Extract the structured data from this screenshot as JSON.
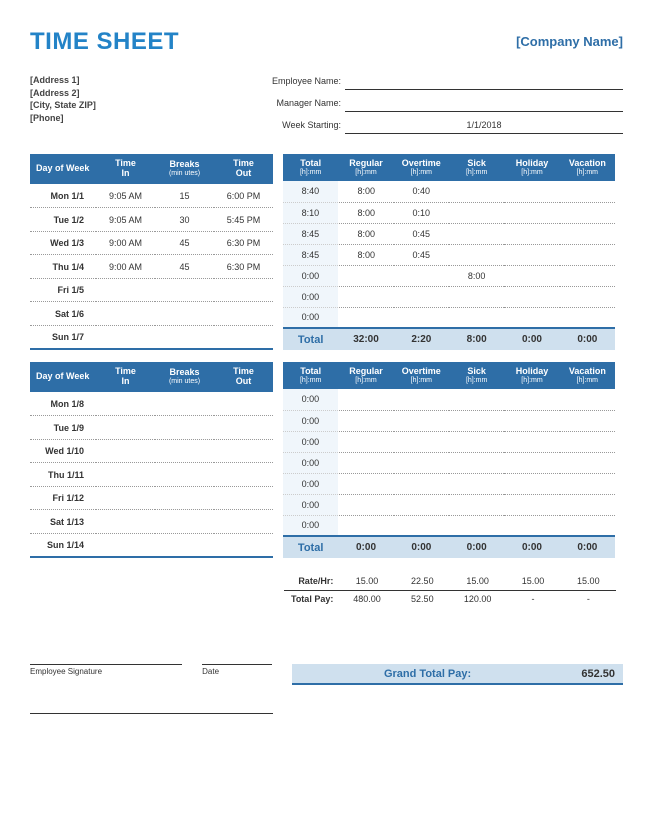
{
  "title": "TIME SHEET",
  "company": "[Company Name]",
  "address": [
    "[Address 1]",
    "[Address 2]",
    "[City, State  ZIP]",
    "[Phone]"
  ],
  "employee": {
    "name_label": "Employee Name:",
    "name_value": "",
    "manager_label": "Manager Name:",
    "manager_value": "",
    "week_label": "Week Starting:",
    "week_value": "1/1/2018"
  },
  "headers_left": [
    "Day of Week",
    "Time\nIn",
    "Breaks",
    "Time\nOut"
  ],
  "headers_left_sub": [
    "",
    "",
    "(min utes)",
    ""
  ],
  "headers_right": [
    "Total",
    "Regular",
    "Overtime",
    "Sick",
    "Holiday",
    "Vacation"
  ],
  "headers_right_sub": "[h]:mm",
  "week1": {
    "rows": [
      {
        "day": "Mon 1/1",
        "in": "9:05 AM",
        "breaks": "15",
        "out": "6:00 PM",
        "total": "8:40",
        "reg": "8:00",
        "ot": "0:40",
        "sick": "",
        "hol": "",
        "vac": ""
      },
      {
        "day": "Tue 1/2",
        "in": "9:05 AM",
        "breaks": "30",
        "out": "5:45 PM",
        "total": "8:10",
        "reg": "8:00",
        "ot": "0:10",
        "sick": "",
        "hol": "",
        "vac": ""
      },
      {
        "day": "Wed 1/3",
        "in": "9:00 AM",
        "breaks": "45",
        "out": "6:30 PM",
        "total": "8:45",
        "reg": "8:00",
        "ot": "0:45",
        "sick": "",
        "hol": "",
        "vac": ""
      },
      {
        "day": "Thu 1/4",
        "in": "9:00 AM",
        "breaks": "45",
        "out": "6:30 PM",
        "total": "8:45",
        "reg": "8:00",
        "ot": "0:45",
        "sick": "",
        "hol": "",
        "vac": ""
      },
      {
        "day": "Fri 1/5",
        "in": "",
        "breaks": "",
        "out": "",
        "total": "0:00",
        "reg": "",
        "ot": "",
        "sick": "8:00",
        "hol": "",
        "vac": ""
      },
      {
        "day": "Sat 1/6",
        "in": "",
        "breaks": "",
        "out": "",
        "total": "0:00",
        "reg": "",
        "ot": "",
        "sick": "",
        "hol": "",
        "vac": ""
      },
      {
        "day": "Sun 1/7",
        "in": "",
        "breaks": "",
        "out": "",
        "total": "0:00",
        "reg": "",
        "ot": "",
        "sick": "",
        "hol": "",
        "vac": ""
      }
    ],
    "total_label": "Total",
    "totals": [
      "32:00",
      "2:20",
      "8:00",
      "0:00",
      "0:00"
    ]
  },
  "week2": {
    "rows": [
      {
        "day": "Mon 1/8",
        "in": "",
        "breaks": "",
        "out": "",
        "total": "0:00",
        "reg": "",
        "ot": "",
        "sick": "",
        "hol": "",
        "vac": ""
      },
      {
        "day": "Tue 1/9",
        "in": "",
        "breaks": "",
        "out": "",
        "total": "0:00",
        "reg": "",
        "ot": "",
        "sick": "",
        "hol": "",
        "vac": ""
      },
      {
        "day": "Wed 1/10",
        "in": "",
        "breaks": "",
        "out": "",
        "total": "0:00",
        "reg": "",
        "ot": "",
        "sick": "",
        "hol": "",
        "vac": ""
      },
      {
        "day": "Thu 1/11",
        "in": "",
        "breaks": "",
        "out": "",
        "total": "0:00",
        "reg": "",
        "ot": "",
        "sick": "",
        "hol": "",
        "vac": ""
      },
      {
        "day": "Fri 1/12",
        "in": "",
        "breaks": "",
        "out": "",
        "total": "0:00",
        "reg": "",
        "ot": "",
        "sick": "",
        "hol": "",
        "vac": ""
      },
      {
        "day": "Sat 1/13",
        "in": "",
        "breaks": "",
        "out": "",
        "total": "0:00",
        "reg": "",
        "ot": "",
        "sick": "",
        "hol": "",
        "vac": ""
      },
      {
        "day": "Sun 1/14",
        "in": "",
        "breaks": "",
        "out": "",
        "total": "0:00",
        "reg": "",
        "ot": "",
        "sick": "",
        "hol": "",
        "vac": ""
      }
    ],
    "total_label": "Total",
    "totals": [
      "0:00",
      "0:00",
      "0:00",
      "0:00",
      "0:00"
    ]
  },
  "rates": {
    "rate_label": "Rate/Hr:",
    "rate_values": [
      "15.00",
      "22.50",
      "15.00",
      "15.00",
      "15.00"
    ],
    "pay_label": "Total Pay:",
    "pay_values": [
      "480.00",
      "52.50",
      "120.00",
      "-",
      "-"
    ]
  },
  "signature": {
    "emp": "Employee Signature",
    "date": "Date"
  },
  "grand": {
    "label": "Grand Total Pay:",
    "value": "652.50"
  }
}
